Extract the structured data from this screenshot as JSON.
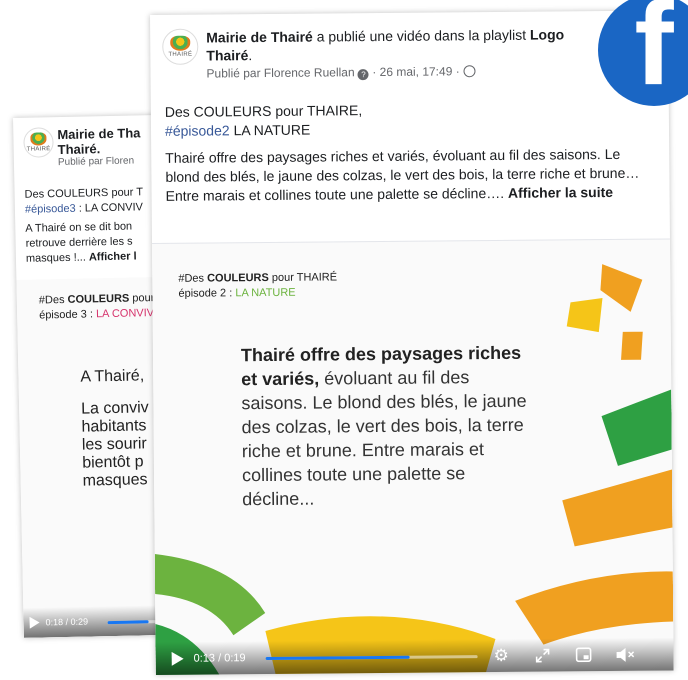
{
  "back_post": {
    "page_name": "Mairie de Tha",
    "page_name_2": "Thairé.",
    "published_by": "Publié par Floren",
    "line1": "Des COULEURS pour T",
    "hashtag": "#épisode3",
    "line2_rest": " : LA CONVIV",
    "body1": "A Thairé on se dit bon",
    "body2": "retrouve derrière les s",
    "body3": "masques !...",
    "see_more": "Afficher l",
    "video_title_pre": "#Des ",
    "video_title_bold": "COULEURS",
    "video_title_post": " pour",
    "video_episode": "épisode 3 : ",
    "video_episode_name": "LA CONVIV",
    "video_text_1": "A Thairé,",
    "video_text_2": "La conviv",
    "video_text_3": "habitants",
    "video_text_4": "les sourir",
    "video_text_5": "bientôt p",
    "video_text_6": "masques",
    "time": "0:18 / 0:29",
    "progress": 0.62
  },
  "front_post": {
    "page_name": "Mairie de Thairé",
    "published_text": " a publié une vidéo dans la playlist ",
    "playlist_name": "Logo",
    "playlist_name_2": "Thairé",
    "published_by": "Publié par Florence Ruellan",
    "date": "26 mai, 17:49",
    "line1": "Des COULEURS pour THAIRE,",
    "hashtag": "#épisode2",
    "line2_rest": " LA NATURE",
    "body": "Thairé offre des paysages riches et variés, évoluant au fil des saisons. Le blond des blés, le jaune des colzas, le vert des bois, la terre riche et brune… Entre marais et collines toute une palette se décline….",
    "see_more": "Afficher la suite",
    "video_title_pre": "#Des ",
    "video_title_bold": "COULEURS",
    "video_title_post": " pour THAIRÉ",
    "video_episode": "épisode 2 : ",
    "video_episode_name": "LA NATURE",
    "video_text_bold": "Thairé offre des paysages riches et variés,",
    "video_text_rest": " évoluant au fil des saisons. Le blond des blés, le jaune des colzas, le vert des bois, la terre riche et brune. Entre marais et collines toute une palette se décline...",
    "time": "0:13 / 0:19",
    "progress": 0.68
  },
  "logo_word": "THAIRÉ",
  "facebook_glyph": "f",
  "colors": {
    "accent": "#1877f2",
    "facebook": "#1a66c4",
    "green": "#6cb33f",
    "yellow": "#f5c518",
    "orange": "#f0a020"
  }
}
